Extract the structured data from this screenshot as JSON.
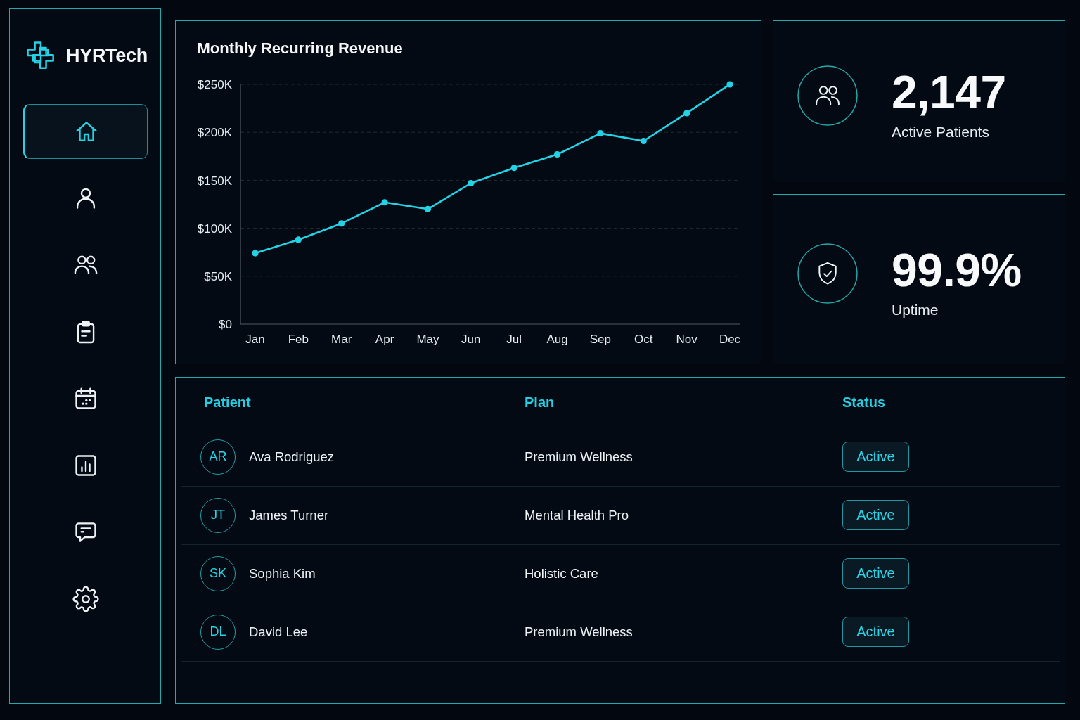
{
  "sidebar": {
    "brand": "HYRTech",
    "nav": [
      {
        "kind": "home",
        "selected": true
      },
      {
        "kind": "person",
        "selected": false
      },
      {
        "kind": "people",
        "selected": false
      },
      {
        "kind": "clipboard",
        "selected": false
      },
      {
        "kind": "calendar",
        "selected": false
      },
      {
        "kind": "chart",
        "selected": false
      },
      {
        "kind": "chat",
        "selected": false
      },
      {
        "kind": "settings",
        "selected": false
      }
    ]
  },
  "revenue_panel": {
    "chart_data": {
      "type": "line",
      "title": "Monthly Recurring Revenue",
      "categories": [
        "Jan",
        "Feb",
        "Mar",
        "Apr",
        "May",
        "Jun",
        "Jul",
        "Aug",
        "Sep",
        "Oct",
        "Nov",
        "Dec"
      ],
      "series": [
        {
          "color": "#22d3e6",
          "marker": "circle",
          "values": [
            74000,
            88000,
            105000,
            127000,
            120000,
            147000,
            163000,
            177000,
            199000,
            191000,
            220000,
            250000
          ]
        }
      ],
      "ylim": [
        0,
        250000
      ],
      "yticks": [
        {
          "value": 0,
          "label": "$0"
        },
        {
          "value": 50000,
          "label": "$50K"
        },
        {
          "value": 100000,
          "label": "$100K"
        },
        {
          "value": 150000,
          "label": "$150K"
        },
        {
          "value": 200000,
          "label": "$200K"
        },
        {
          "value": 250000,
          "label": "$250K"
        }
      ],
      "grid": true
    }
  },
  "stats": [
    {
      "kind": "people",
      "value": "2,147",
      "label": "Active Patients"
    },
    {
      "kind": "shield",
      "value": "99.9%",
      "label": "Uptime"
    }
  ],
  "patients_table": {
    "columns": [
      "Patient",
      "Plan",
      "Status"
    ],
    "rows": [
      {
        "initials": "AR",
        "patient": "Ava Rodriguez",
        "plan": "Premium Wellness",
        "status": "Active"
      },
      {
        "initials": "JT",
        "patient": "James Turner",
        "plan": "Mental Health Pro",
        "status": "Active"
      },
      {
        "initials": "SK",
        "patient": "Sophia Kim",
        "plan": "Holistic Care",
        "status": "Active"
      },
      {
        "initials": "DL",
        "patient": "David Lee",
        "plan": "Premium Wellness",
        "status": "Active"
      }
    ]
  }
}
